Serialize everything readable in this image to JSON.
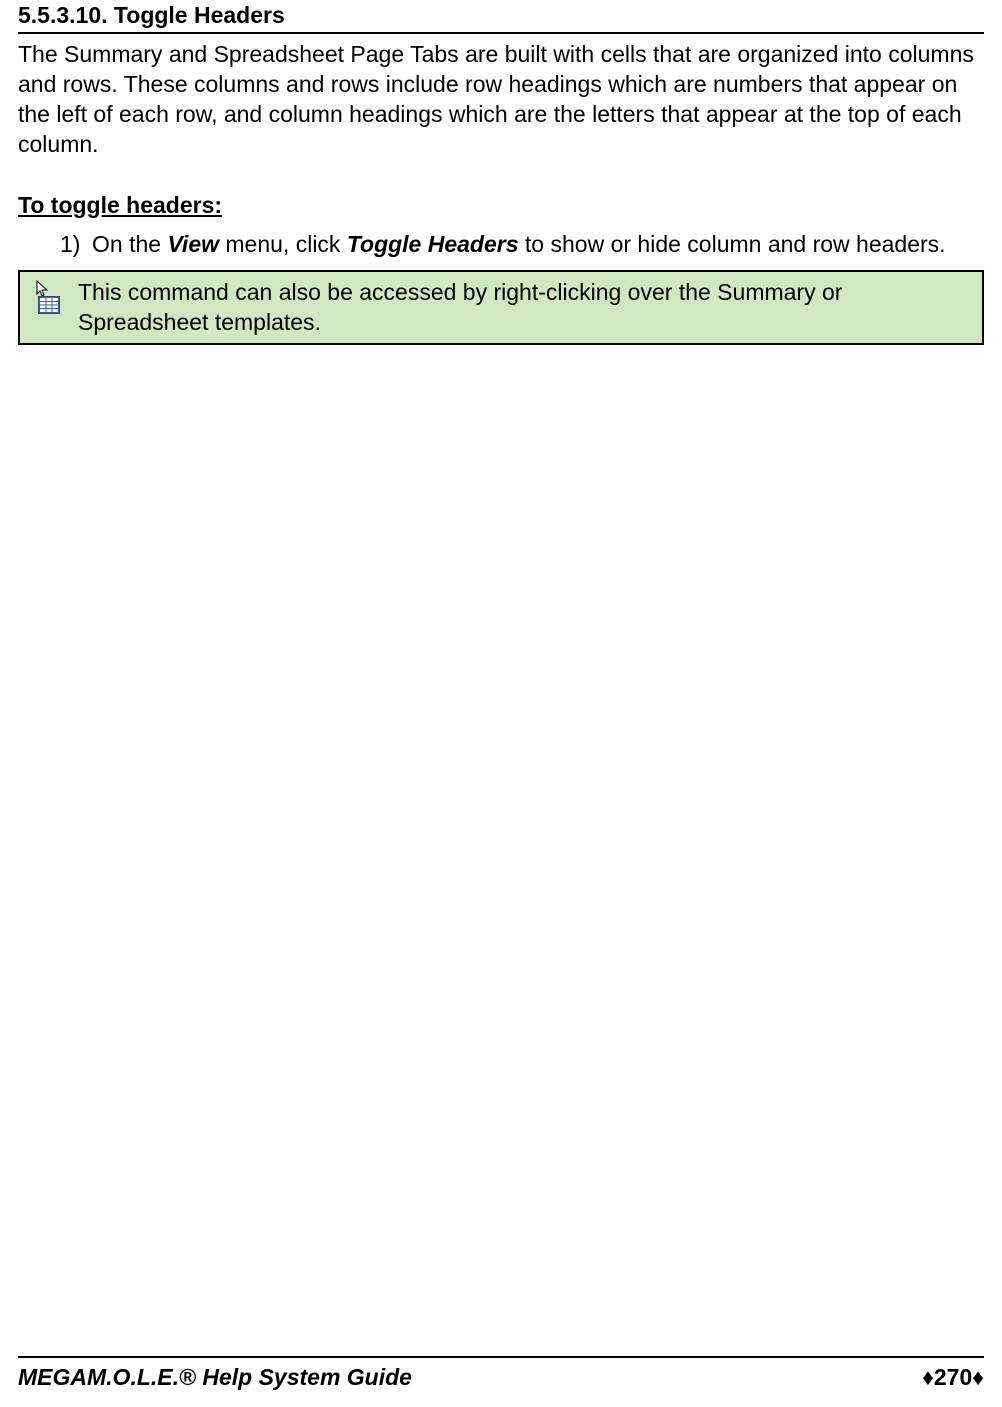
{
  "section": {
    "number": "5.5.3.10.",
    "title": "Toggle Headers",
    "intro": "The Summary and Spreadsheet Page Tabs are built with cells that are organized into columns and rows. These columns and rows include row headings which are numbers that appear on the left of each row, and column headings which are the letters that appear at the top of each column.",
    "procedure_heading": "To toggle headers:",
    "steps": [
      {
        "marker": "1)",
        "pre": "On the ",
        "menu": "View",
        "mid": " menu, click ",
        "command": "Toggle Headers",
        "post": " to show or hide column and row headers."
      }
    ],
    "note": "This command can also be accessed by right-clicking over the Summary or Spreadsheet templates."
  },
  "footer": {
    "title_prefix": "MEGA",
    "title_rest": "M.O.L.E.® Help System Guide",
    "page_number": "270",
    "diamond": "♦"
  }
}
